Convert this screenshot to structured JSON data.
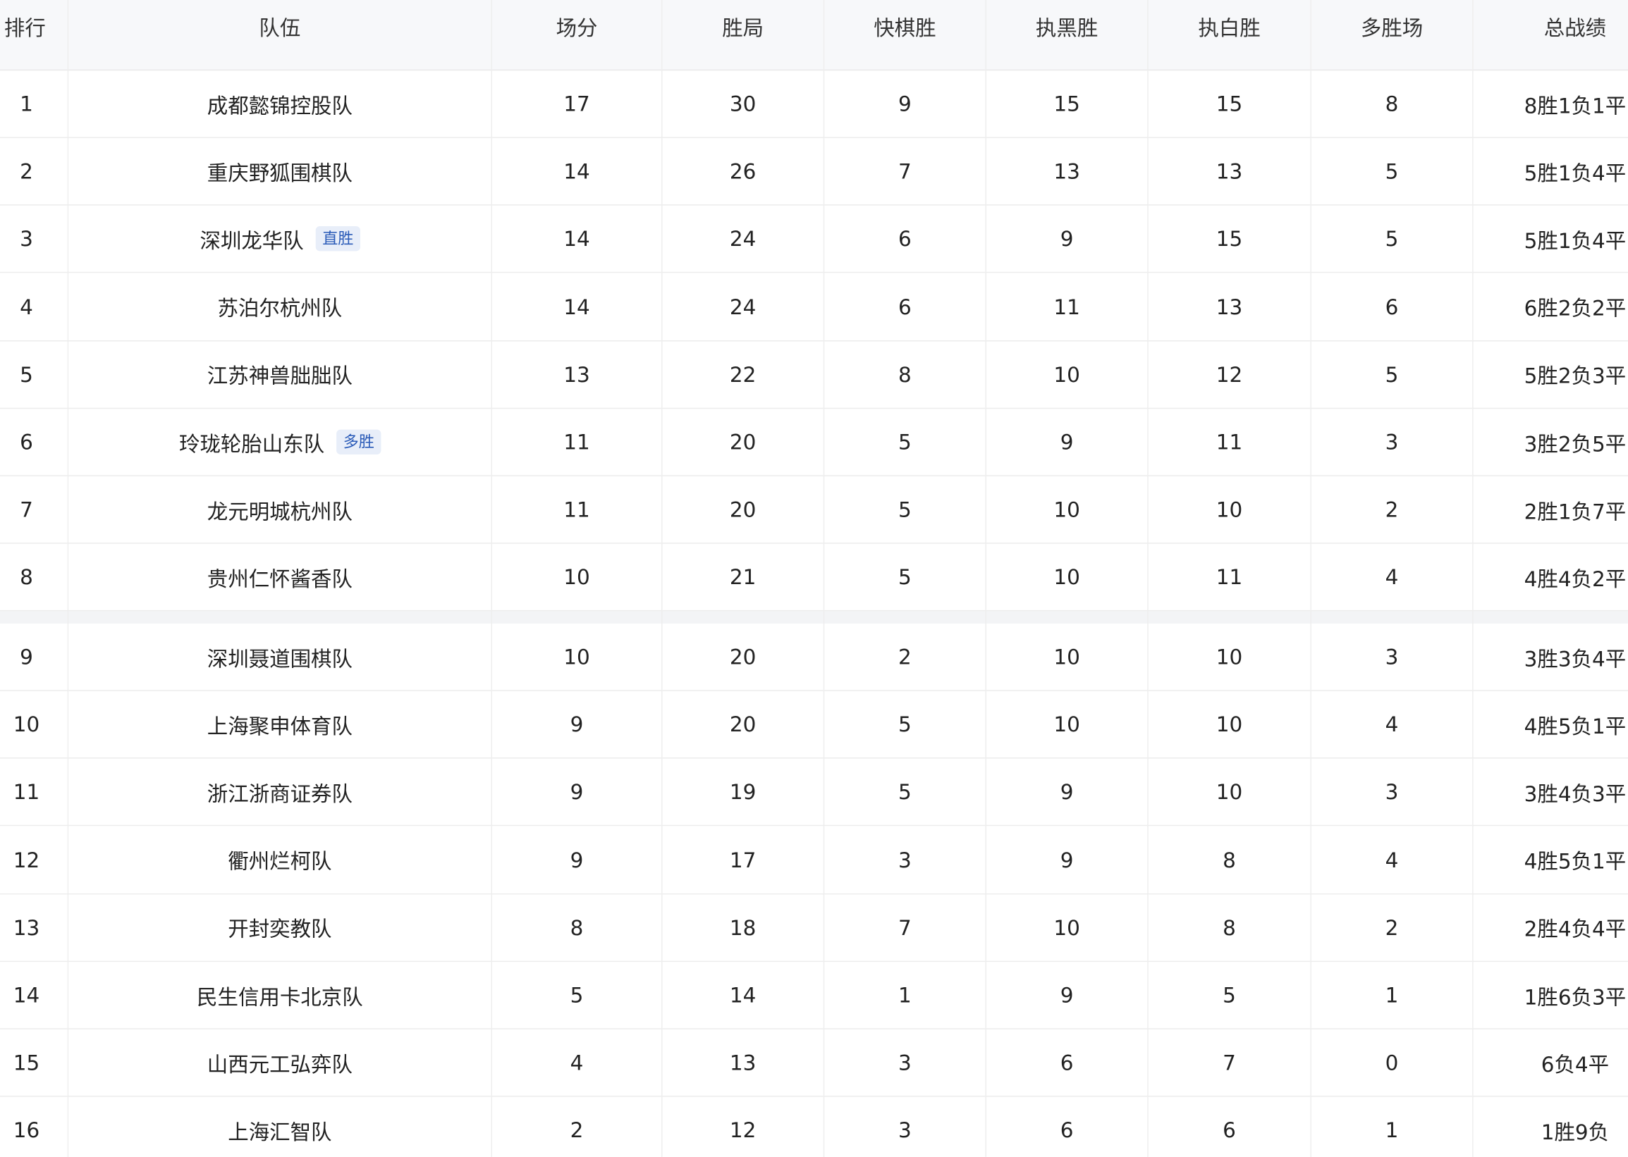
{
  "table": {
    "headers": {
      "rank": "排行",
      "team": "队伍",
      "points": "场分",
      "wins": "胜局",
      "rapid_wins": "快棋胜",
      "black_wins": "执黑胜",
      "white_wins": "执白胜",
      "multi_win_matches": "多胜场",
      "record": "总战绩"
    },
    "rows": [
      {
        "rank": "1",
        "team": "成都懿锦控股队",
        "badge": "",
        "points": "17",
        "wins": "30",
        "rapid_wins": "9",
        "black_wins": "15",
        "white_wins": "15",
        "multi_win_matches": "8",
        "record": "8胜1负1平"
      },
      {
        "rank": "2",
        "team": "重庆野狐围棋队",
        "badge": "",
        "points": "14",
        "wins": "26",
        "rapid_wins": "7",
        "black_wins": "13",
        "white_wins": "13",
        "multi_win_matches": "5",
        "record": "5胜1负4平"
      },
      {
        "rank": "3",
        "team": "深圳龙华队",
        "badge": "直胜",
        "points": "14",
        "wins": "24",
        "rapid_wins": "6",
        "black_wins": "9",
        "white_wins": "15",
        "multi_win_matches": "5",
        "record": "5胜1负4平"
      },
      {
        "rank": "4",
        "team": "苏泊尔杭州队",
        "badge": "",
        "points": "14",
        "wins": "24",
        "rapid_wins": "6",
        "black_wins": "11",
        "white_wins": "13",
        "multi_win_matches": "6",
        "record": "6胜2负2平"
      },
      {
        "rank": "5",
        "team": "江苏神兽朏朏队",
        "badge": "",
        "points": "13",
        "wins": "22",
        "rapid_wins": "8",
        "black_wins": "10",
        "white_wins": "12",
        "multi_win_matches": "5",
        "record": "5胜2负3平"
      },
      {
        "rank": "6",
        "team": "玲珑轮胎山东队",
        "badge": "多胜",
        "points": "11",
        "wins": "20",
        "rapid_wins": "5",
        "black_wins": "9",
        "white_wins": "11",
        "multi_win_matches": "3",
        "record": "3胜2负5平"
      },
      {
        "rank": "7",
        "team": "龙元明城杭州队",
        "badge": "",
        "points": "11",
        "wins": "20",
        "rapid_wins": "5",
        "black_wins": "10",
        "white_wins": "10",
        "multi_win_matches": "2",
        "record": "2胜1负7平"
      },
      {
        "rank": "8",
        "team": "贵州仁怀酱香队",
        "badge": "",
        "points": "10",
        "wins": "21",
        "rapid_wins": "5",
        "black_wins": "10",
        "white_wins": "11",
        "multi_win_matches": "4",
        "record": "4胜4负2平"
      },
      {
        "rank": "9",
        "team": "深圳聂道围棋队",
        "badge": "",
        "points": "10",
        "wins": "20",
        "rapid_wins": "2",
        "black_wins": "10",
        "white_wins": "10",
        "multi_win_matches": "3",
        "record": "3胜3负4平"
      },
      {
        "rank": "10",
        "team": "上海聚申体育队",
        "badge": "",
        "points": "9",
        "wins": "20",
        "rapid_wins": "5",
        "black_wins": "10",
        "white_wins": "10",
        "multi_win_matches": "4",
        "record": "4胜5负1平"
      },
      {
        "rank": "11",
        "team": "浙江浙商证券队",
        "badge": "",
        "points": "9",
        "wins": "19",
        "rapid_wins": "5",
        "black_wins": "9",
        "white_wins": "10",
        "multi_win_matches": "3",
        "record": "3胜4负3平"
      },
      {
        "rank": "12",
        "team": "衢州烂柯队",
        "badge": "",
        "points": "9",
        "wins": "17",
        "rapid_wins": "3",
        "black_wins": "9",
        "white_wins": "8",
        "multi_win_matches": "4",
        "record": "4胜5负1平"
      },
      {
        "rank": "13",
        "team": "开封奕教队",
        "badge": "",
        "points": "8",
        "wins": "18",
        "rapid_wins": "7",
        "black_wins": "10",
        "white_wins": "8",
        "multi_win_matches": "2",
        "record": "2胜4负4平"
      },
      {
        "rank": "14",
        "team": "民生信用卡北京队",
        "badge": "",
        "points": "5",
        "wins": "14",
        "rapid_wins": "1",
        "black_wins": "9",
        "white_wins": "5",
        "multi_win_matches": "1",
        "record": "1胜6负3平"
      },
      {
        "rank": "15",
        "team": "山西元工弘弈队",
        "badge": "",
        "points": "4",
        "wins": "13",
        "rapid_wins": "3",
        "black_wins": "6",
        "white_wins": "7",
        "multi_win_matches": "0",
        "record": "6负4平"
      },
      {
        "rank": "16",
        "team": "上海汇智队",
        "badge": "",
        "points": "2",
        "wins": "12",
        "rapid_wins": "3",
        "black_wins": "6",
        "white_wins": "6",
        "multi_win_matches": "1",
        "record": "1胜9负"
      }
    ]
  }
}
